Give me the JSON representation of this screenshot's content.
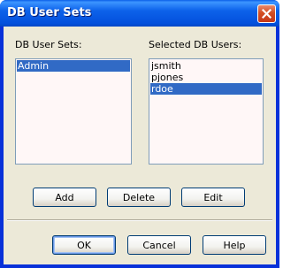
{
  "window": {
    "title": "DB User Sets"
  },
  "icons": {
    "close": "close-icon"
  },
  "colors": {
    "titlebar": "#0350dc",
    "selection": "#316ac5",
    "dialog_bg": "#ece9d8",
    "close_button": "#d34e23"
  },
  "left_list": {
    "label": "DB User Sets:",
    "items": [
      {
        "text": "Admin",
        "selected": true
      }
    ]
  },
  "right_list": {
    "label": "Selected DB Users:",
    "items": [
      {
        "text": "jsmith",
        "selected": false
      },
      {
        "text": "pjones",
        "selected": false
      },
      {
        "text": "rdoe",
        "selected": true
      }
    ]
  },
  "actions": {
    "add": "Add",
    "delete": "Delete",
    "edit": "Edit"
  },
  "footer": {
    "ok": "OK",
    "cancel": "Cancel",
    "help": "Help"
  }
}
